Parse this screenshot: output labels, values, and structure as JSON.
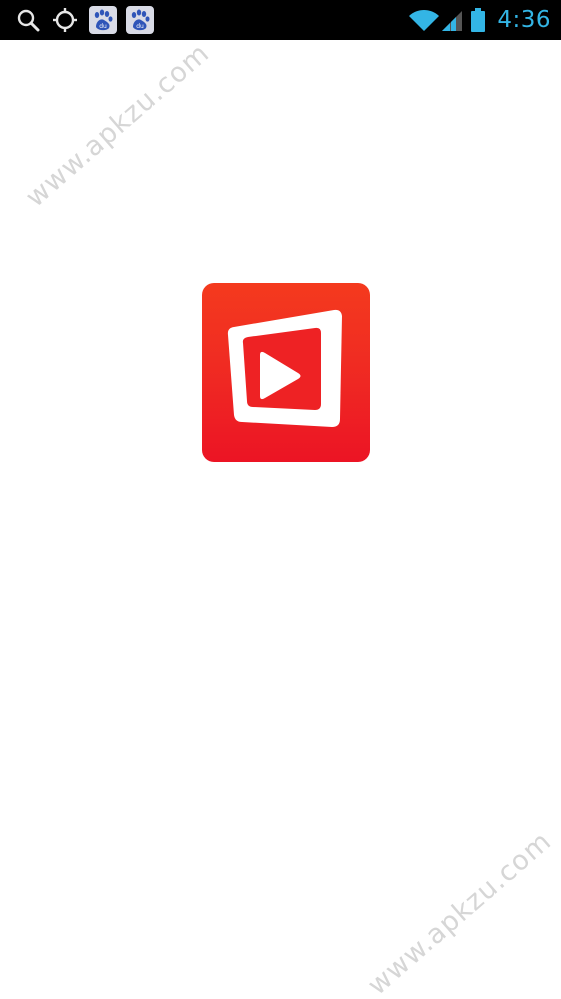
{
  "status_bar": {
    "time": "4:36",
    "time_color": "#33b5e5",
    "notification_icons": [
      "search-icon",
      "gps-icon",
      "baidu-paw-icon",
      "baidu-paw-icon"
    ],
    "baidu_label": "du",
    "system_icons": [
      "wifi-icon",
      "signal-icon",
      "battery-icon"
    ]
  },
  "splash": {
    "logo_icon": "video-play-icon",
    "logo_colors": {
      "top": "#f43a1e",
      "bottom": "#ec1424",
      "play_symbol": "#ffffff"
    }
  },
  "watermarks": {
    "top_text": "www.apkzu.com",
    "bottom_text": "www.apkzu.com"
  }
}
